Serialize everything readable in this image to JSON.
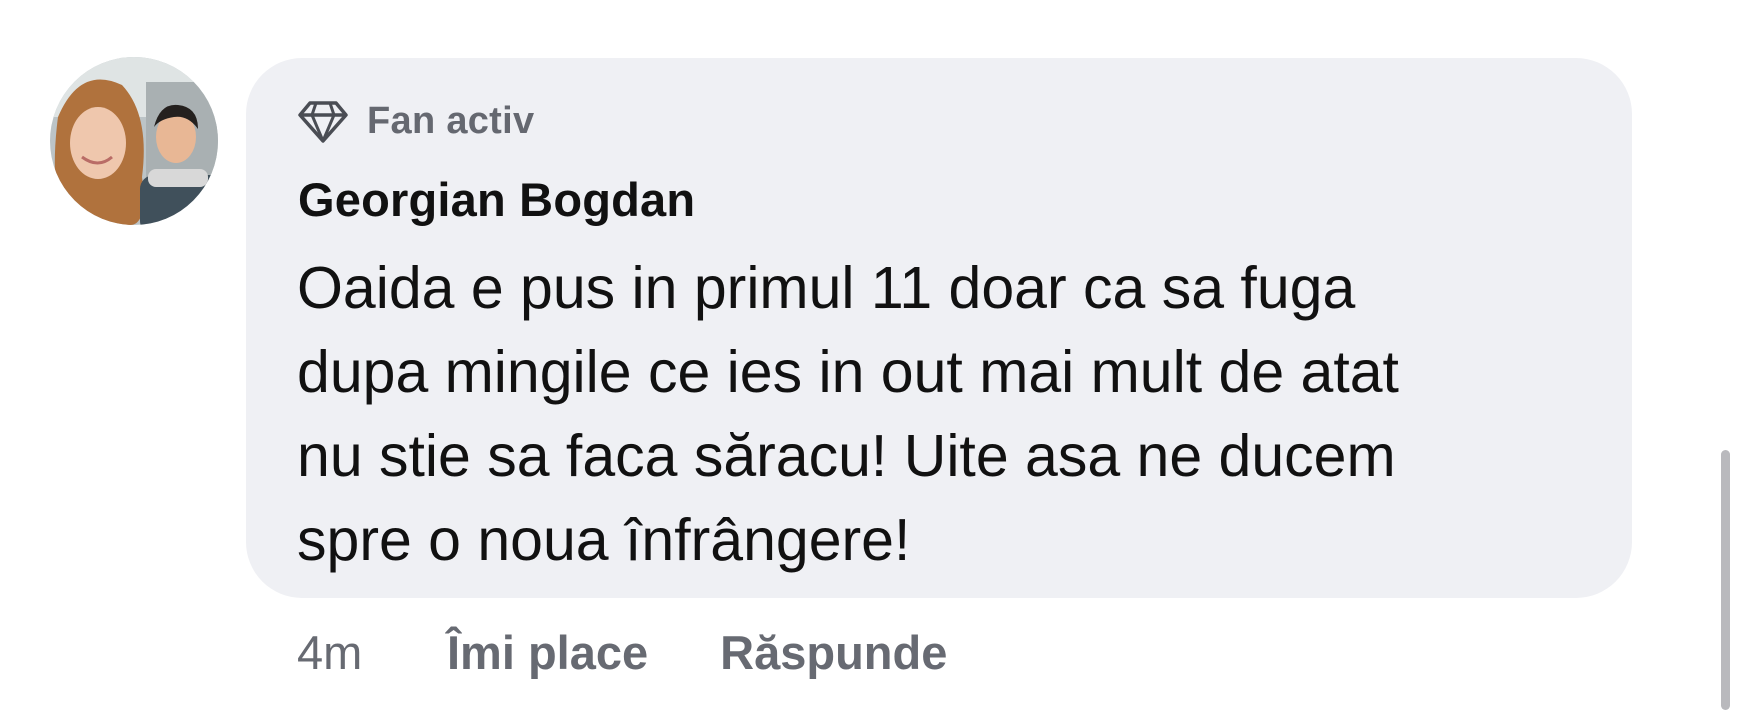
{
  "comment": {
    "badge": {
      "icon": "diamond-icon",
      "label": "Fan activ"
    },
    "author": "Georgian Bogdan",
    "text_lines": [
      "Oaida e pus in primul 11 doar ca sa fuga",
      "dupa mingile ce ies in out mai mult de atat",
      "nu stie sa faca săracu! Uite asa ne ducem",
      "spre o noua înfrângere!"
    ],
    "time": "4m",
    "actions": {
      "like_label": "Îmi place",
      "reply_label": "Răspunde"
    }
  },
  "colors": {
    "bubble": "#eff0f4",
    "text": "#111111",
    "muted": "#656870"
  }
}
